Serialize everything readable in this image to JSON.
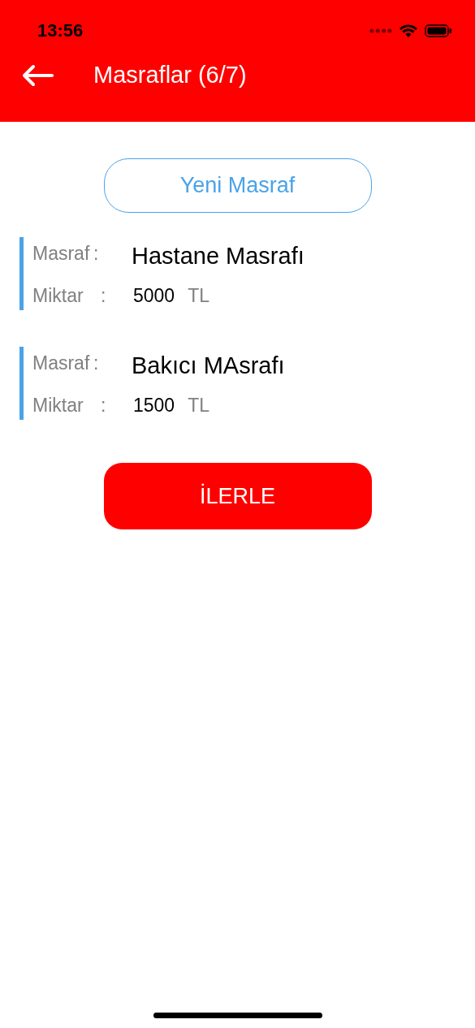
{
  "status_bar": {
    "time": "13:56"
  },
  "header": {
    "title": "Masraflar (6/7)"
  },
  "new_button": {
    "label": "Yeni Masraf"
  },
  "expenses": [
    {
      "name_label": "Masraf",
      "name_sep": ":",
      "name": "Hastane Masrafı",
      "amount_label": "Miktar",
      "amount_sep": ":",
      "amount": "5000",
      "currency": "TL"
    },
    {
      "name_label": "Masraf",
      "name_sep": ":",
      "name": "Bakıcı MAsrafı",
      "amount_label": "Miktar",
      "amount_sep": ":",
      "amount": "1500",
      "currency": "TL"
    }
  ],
  "next_button": {
    "label": "İLERLE"
  }
}
